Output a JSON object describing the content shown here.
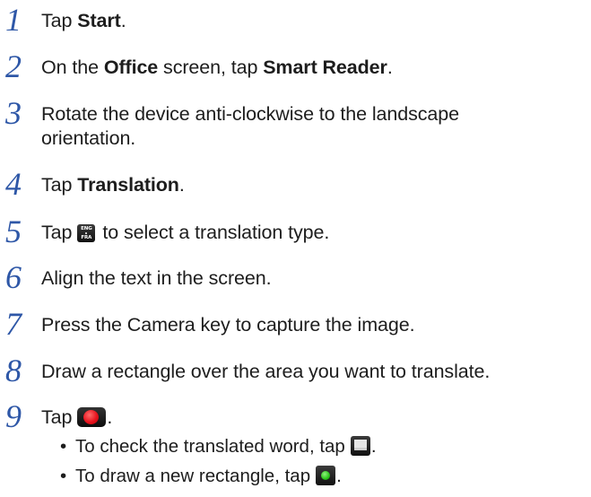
{
  "steps": [
    {
      "num": "1",
      "pre": "Tap ",
      "b1": "Start",
      "post": "."
    },
    {
      "num": "2",
      "pre": "On the ",
      "b1": "Office",
      "mid": " screen, tap ",
      "b2": "Smart Reader",
      "post": "."
    },
    {
      "num": "3",
      "line1": "Rotate the device anti-clockwise to the landscape",
      "line2": "orientation."
    },
    {
      "num": "4",
      "pre": "Tap ",
      "b1": "Translation",
      "post": "."
    },
    {
      "num": "5",
      "pre": "Tap",
      "icon_top": "ENG",
      "icon_bottom": "FRA",
      "post": "to select a translation type."
    },
    {
      "num": "6",
      "text": "Align the text in the screen."
    },
    {
      "num": "7",
      "text": "Press the Camera key to capture the image."
    },
    {
      "num": "8",
      "text": "Draw a rectangle over the area you want to translate."
    },
    {
      "num": "9",
      "pre": "Tap",
      "post": "."
    }
  ],
  "bullets": [
    {
      "marker": "•",
      "text": "To check the translated word, tap",
      "post": "."
    },
    {
      "marker": "•",
      "text": "To draw a new rectangle, tap",
      "post": "."
    }
  ],
  "icons": {
    "step5": "language-pair-icon",
    "step9": "record-icon",
    "bullet1": "translated-word-icon",
    "bullet2": "new-rectangle-icon"
  },
  "colors": {
    "step_number": "#2e57a7",
    "body_text": "#1d1d1d",
    "record_red": "#e8141e",
    "new_green": "#29c419"
  }
}
